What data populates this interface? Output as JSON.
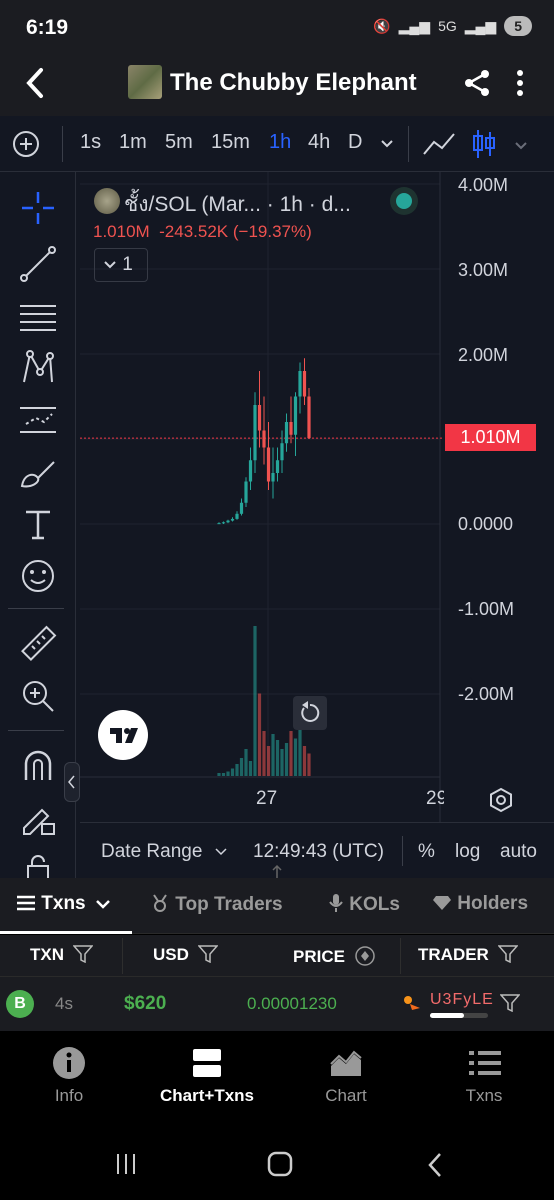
{
  "status": {
    "time": "6:19",
    "icons": [
      "mute-icon",
      "signal-icon",
      "5g-icon",
      "signal-icon"
    ],
    "battery": "5"
  },
  "header": {
    "title": "The Chubby Elephant"
  },
  "timeframes": [
    "1s",
    "1m",
    "5m",
    "15m",
    "1h",
    "4h",
    "D"
  ],
  "active_timeframe": "1h",
  "legend": {
    "name": "ชั้ง/SOL (Mar... · 1h · d...",
    "values": "1.010M  -243.52K (−19.37%)",
    "collapse": "1"
  },
  "chart_data": {
    "type": "candlestick",
    "y_ticks": [
      "4.00M",
      "3.00M",
      "2.00M",
      "0.0000",
      "-1.00M",
      "-2.00M"
    ],
    "x_ticks": [
      "27",
      "29"
    ],
    "last_price_label": "1.010M",
    "ohlc": [
      [
        0.0,
        0.02,
        0.0,
        0.01
      ],
      [
        0.01,
        0.03,
        0.0,
        0.02
      ],
      [
        0.02,
        0.05,
        0.01,
        0.04
      ],
      [
        0.04,
        0.08,
        0.03,
        0.06
      ],
      [
        0.06,
        0.15,
        0.05,
        0.12
      ],
      [
        0.12,
        0.3,
        0.1,
        0.25
      ],
      [
        0.25,
        0.55,
        0.2,
        0.5
      ],
      [
        0.5,
        0.9,
        0.4,
        0.75
      ],
      [
        0.75,
        1.55,
        0.6,
        1.4
      ],
      [
        1.4,
        1.8,
        0.9,
        1.1
      ],
      [
        1.1,
        1.5,
        0.7,
        0.9
      ],
      [
        0.9,
        1.2,
        0.4,
        0.5
      ],
      [
        0.5,
        0.9,
        0.3,
        0.6
      ],
      [
        0.6,
        0.9,
        0.5,
        0.75
      ],
      [
        0.75,
        1.1,
        0.6,
        0.95
      ],
      [
        0.95,
        1.3,
        0.85,
        1.2
      ],
      [
        1.2,
        1.5,
        0.95,
        1.05
      ],
      [
        1.05,
        1.55,
        0.8,
        1.5
      ],
      [
        1.5,
        1.9,
        1.3,
        1.8
      ],
      [
        1.8,
        1.95,
        1.4,
        1.5
      ],
      [
        1.5,
        1.6,
        1.0,
        1.01
      ]
    ],
    "volume": [
      2,
      2,
      3,
      5,
      8,
      12,
      18,
      10,
      100,
      55,
      30,
      20,
      28,
      24,
      18,
      22,
      30,
      25,
      40,
      20,
      15
    ]
  },
  "chart_bottom": {
    "date_range": "Date Range",
    "time": "12:49:43 (UTC)",
    "percent": "%",
    "log": "log",
    "auto": "auto"
  },
  "tabs": [
    {
      "label": "Txns"
    },
    {
      "label": "Top Traders"
    },
    {
      "label": "KOLs"
    },
    {
      "label": "Holders"
    }
  ],
  "table": {
    "headers": [
      "TXN",
      "USD",
      "PRICE",
      "TRADER"
    ],
    "rows": [
      {
        "type": "B",
        "age": "4s",
        "usd": "$620",
        "price": "0.00001230",
        "trader": "U3FyLE"
      }
    ]
  },
  "nav": [
    {
      "label": "Info"
    },
    {
      "label": "Chart+Txns"
    },
    {
      "label": "Chart"
    },
    {
      "label": "Txns"
    }
  ],
  "colors": {
    "up": "#26a69a",
    "down": "#ef5350",
    "accent": "#2962ff",
    "buy": "#4caf50"
  }
}
